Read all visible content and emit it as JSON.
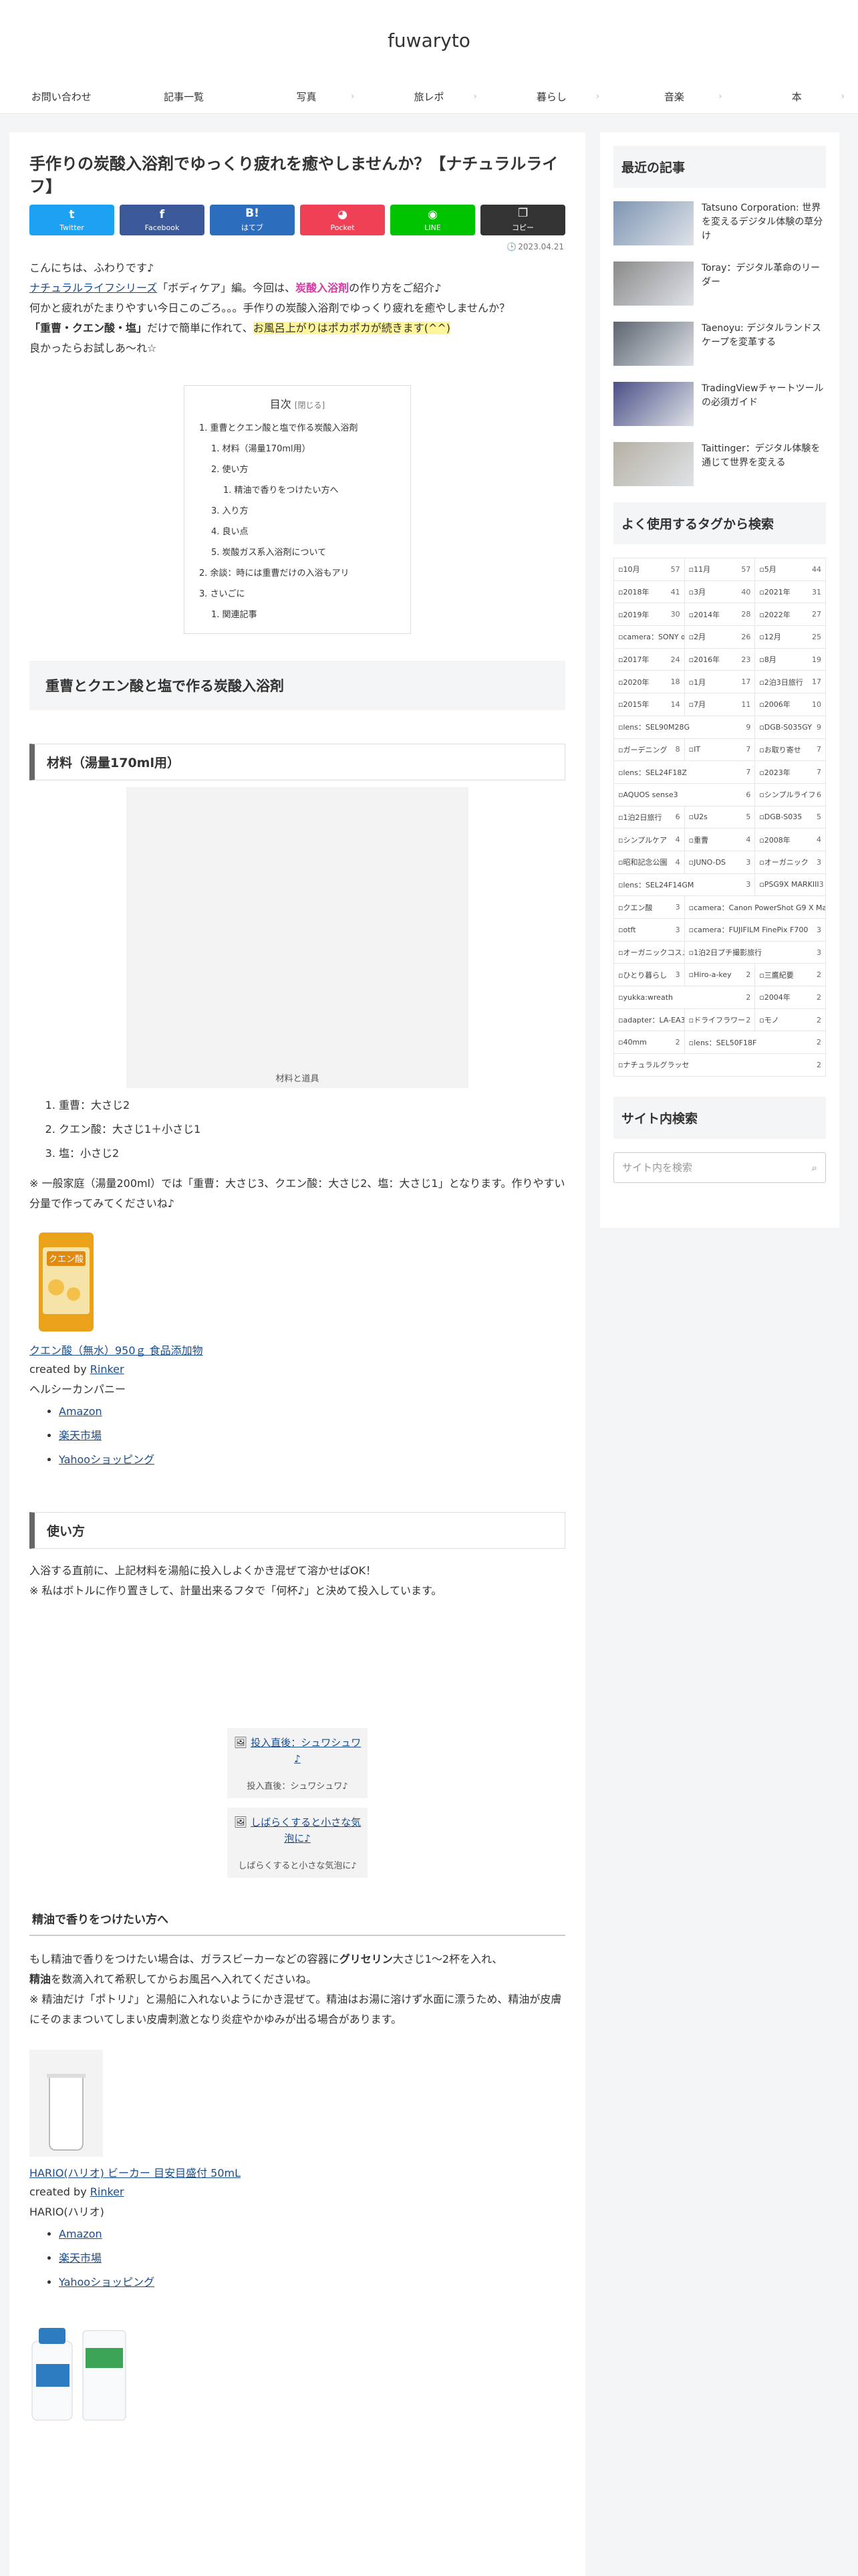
{
  "site": {
    "title": "fuwaryto"
  },
  "nav": [
    "お問い合わせ",
    "記事一覧",
    "写真",
    "旅レポ",
    "暮らし",
    "音楽",
    "本"
  ],
  "article": {
    "title": "手作りの炭酸入浴剤でゆっくり疲れを癒やしませんか？【ナチュラルライフ】",
    "share": [
      {
        "label": "Twitter",
        "icon": "t",
        "color": "#1da1f2"
      },
      {
        "label": "Facebook",
        "icon": "f",
        "color": "#3b5998"
      },
      {
        "label": "はてブ",
        "icon": "B!",
        "color": "#2c6ebd"
      },
      {
        "label": "Pocket",
        "icon": "◕",
        "color": "#ef4056"
      },
      {
        "label": "LINE",
        "icon": "◉",
        "color": "#00c300"
      },
      {
        "label": "コピー",
        "icon": "❐",
        "color": "#333333"
      }
    ],
    "date": "2023.04.21",
    "intro1": "こんにちは、ふわりです♪",
    "intro2_link": "ナチュラルライフシリーズ",
    "intro2_rest1": "「ボディケア」編。今回は、",
    "intro2_hl": "炭酸入浴剤",
    "intro2_rest2": "の作り方をご紹介♪",
    "intro3": "何かと疲れがたまりやすい今日このごろ。。。手作りの炭酸入浴剤でゆっくり疲れを癒やしませんか？",
    "intro4_bold": "「重曹・クエン酸・塩」",
    "intro4_rest": "だけで簡単に作れて、",
    "intro4_hl": "お風呂上がりはポカポカが続きます(^^)",
    "intro5": "良かったらお試しあ〜れ☆"
  },
  "toc": {
    "title": "目次",
    "toggle": "[閉じる]",
    "items": [
      "1. 重曹とクエン酸と塩で作る炭酸入浴剤",
      "1. 材料（湯量170ml用）",
      "2. 使い方",
      "1. 精油で香りをつけたい方へ",
      "3. 入り方",
      "4. 良い点",
      "5. 炭酸ガス系入浴剤について",
      "2. 余談：時には重曹だけの入浴もアリ",
      "3. さいごに",
      "1. 関連記事"
    ]
  },
  "sections": {
    "h2_1": "重曹とクエン酸と塩で作る炭酸入浴剤",
    "h3_materials": "材料（湯量170ml用）",
    "figure_caption": "材料と道具",
    "materials": [
      "重曹：大さじ2",
      "クエン酸：大さじ1＋小さじ1",
      "塩：小さじ2"
    ],
    "note": "※ 一般家庭（湯量200ml）では「重曹：大さじ3、クエン酸：大さじ2、塩：大さじ1」となります。作りやすい分量で作ってみてくださいね♪",
    "h3_usage": "使い方",
    "usage1": "入浴する直前に、上記材料を湯船に投入しよくかき混ぜて溶かせばOK！",
    "usage2": "※ 私はボトルに作り置きして、計量出来るフタで「何杯♪」と決めて投入しています。",
    "fig1_link": "投入直後：シュワシュワ♪",
    "fig1_caption": "投入直後：シュワシュワ♪",
    "fig2_link": "しばらくすると小さな気泡に♪",
    "fig2_caption": "しばらくすると小さな気泡に♪",
    "h4_oil": "精油で香りをつけたい方へ",
    "oil1_a": "もし精油で香りをつけたい場合は、ガラスビーカーなどの容器に",
    "oil1_b": "グリセリン",
    "oil1_c": "大さじ1〜2杯を入れ、",
    "oil2_a": "精油",
    "oil2_b": "を数滴入れて希釈してからお風呂へ入れてくださいね。",
    "oil3": "※ 精油だけ「ポトリ♪」と湯船に入れないようにかき混ぜて。精油はお湯に溶けず水面に漂うため、精油が皮膚にそのままついてしまい皮膚刺激となり炎症やかゆみが出る場合があります。"
  },
  "products": [
    {
      "name": "クエン酸（無水）950ｇ 食品添加物",
      "created_by": "created by",
      "creator": "Rinker",
      "maker": "ヘルシーカンパニー",
      "links": [
        "Amazon",
        "楽天市場",
        "Yahooショッピング"
      ],
      "img_label": "クエン酸"
    },
    {
      "name": "HARIO(ハリオ) ビーカー 目安目盛付 50mL",
      "created_by": "created by",
      "creator": "Rinker",
      "maker": "HARIO(ハリオ)",
      "links": [
        "Amazon",
        "楽天市場",
        "Yahooショッピング"
      ]
    }
  ],
  "sidebar": {
    "recent_title": "最近の記事",
    "recent": [
      "Tatsuno Corporation: 世界を変えるデジタル体験の草分け",
      "Toray：デジタル革命のリーダー",
      "Taenoyu: デジタルランドスケープを変革する",
      "TradingViewチャートツールの必須ガイド",
      "Taittinger：デジタル体験を通じて世界を変える"
    ],
    "tags_title": "よく使用するタグから検索",
    "tags": [
      {
        "n": "10月",
        "c": "57"
      },
      {
        "n": "11月",
        "c": "57"
      },
      {
        "n": "5月",
        "c": "44"
      },
      {
        "n": "2018年",
        "c": "41"
      },
      {
        "n": "3月",
        "c": "40"
      },
      {
        "n": "2021年",
        "c": "31"
      },
      {
        "n": "2019年",
        "c": "30"
      },
      {
        "n": "2014年",
        "c": "28"
      },
      {
        "n": "2022年",
        "c": "27"
      },
      {
        "n": "camera：SONY α7II",
        "c": "27"
      },
      {
        "n": "2月",
        "c": "26"
      },
      {
        "n": "12月",
        "c": "25"
      },
      {
        "n": "2017年",
        "c": "24"
      },
      {
        "n": "2016年",
        "c": "23"
      },
      {
        "n": "8月",
        "c": "19"
      },
      {
        "n": "2020年",
        "c": "18"
      },
      {
        "n": "1月",
        "c": "17"
      },
      {
        "n": "2泊3日旅行",
        "c": "17"
      },
      {
        "n": "2015年",
        "c": "14"
      },
      {
        "n": "7月",
        "c": "11"
      },
      {
        "n": "2006年",
        "c": "10"
      },
      {
        "n": "lens：SEL90M28G",
        "c": "9",
        "w": 2
      },
      {
        "n": "DGB-S035GY",
        "c": "9"
      },
      {
        "n": "ガーデニング",
        "c": "8"
      },
      {
        "n": "IT",
        "c": "7"
      },
      {
        "n": "お取り寄せ",
        "c": "7"
      },
      {
        "n": "lens：SEL24F18Z",
        "c": "7",
        "w": 2
      },
      {
        "n": "2023年",
        "c": "7"
      },
      {
        "n": "AQUOS sense3",
        "c": "6",
        "w": 2
      },
      {
        "n": "シンプルライフ",
        "c": "6"
      },
      {
        "n": "1泊2日旅行",
        "c": "6"
      },
      {
        "n": "U2s",
        "c": "5"
      },
      {
        "n": "DGB-S035",
        "c": "5"
      },
      {
        "n": "シンプルケア",
        "c": "4"
      },
      {
        "n": "重曹",
        "c": "4"
      },
      {
        "n": "2008年",
        "c": "4"
      },
      {
        "n": "昭和記念公園",
        "c": "4"
      },
      {
        "n": "JUNO-DS",
        "c": "3"
      },
      {
        "n": "オーガニック",
        "c": "3"
      },
      {
        "n": "lens：SEL24F14GM",
        "c": "3",
        "w": 2
      },
      {
        "n": "PSG9X MARKIII",
        "c": "3"
      },
      {
        "n": "クエン酸",
        "c": "3"
      },
      {
        "n": "camera：Canon PowerShot G9 X MarkII",
        "c": "3",
        "w": 2
      },
      {
        "n": "otft",
        "c": "3"
      },
      {
        "n": "camera：FUJIFILM FinePix F700",
        "c": "3",
        "w": 2
      },
      {
        "n": "オーガニックコスメ",
        "c": "3"
      },
      {
        "n": "1泊2日プチ撮影旅行",
        "c": "3",
        "w": 2
      },
      {
        "n": "ひとり暮らし",
        "c": "3"
      },
      {
        "n": "Hiro-a-key",
        "c": "2"
      },
      {
        "n": "三鷹紀要",
        "c": "2"
      },
      {
        "n": "yukka:wreath",
        "c": "2",
        "w": 2
      },
      {
        "n": "2004年",
        "c": "2"
      },
      {
        "n": "adapter：LA-EA3",
        "c": "2"
      },
      {
        "n": "ドライフラワー",
        "c": "2"
      },
      {
        "n": "モノ",
        "c": "2"
      },
      {
        "n": "40mm",
        "c": "2"
      },
      {
        "n": "lens：SEL50F18F",
        "c": "2",
        "w": 2
      },
      {
        "n": "ナチュラルグラッセ",
        "c": "2",
        "w": 3
      }
    ],
    "search_title": "サイト内検索",
    "search_placeholder": "サイト内を検索"
  }
}
